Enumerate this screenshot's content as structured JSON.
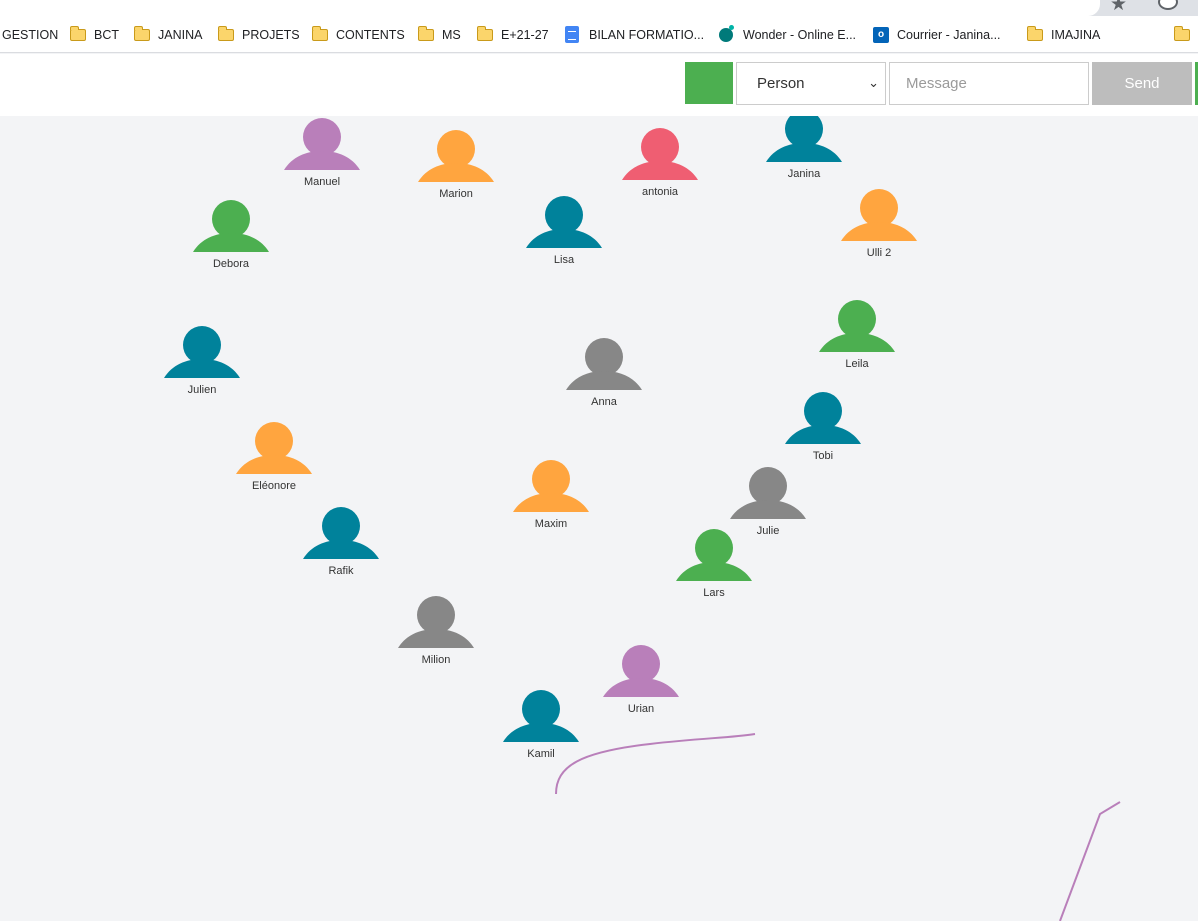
{
  "bookmarks": [
    {
      "label": "GESTION",
      "icon": "none"
    },
    {
      "label": "BCT",
      "icon": "folder-icon"
    },
    {
      "label": "JANINA",
      "icon": "folder-icon"
    },
    {
      "label": "PROJETS",
      "icon": "folder-icon"
    },
    {
      "label": "CONTENTS",
      "icon": "folder-icon"
    },
    {
      "label": "MS",
      "icon": "folder-icon"
    },
    {
      "label": "E+21-27",
      "icon": "folder-icon"
    },
    {
      "label": "BILAN FORMATIO...",
      "icon": "doc-icon"
    },
    {
      "label": "Wonder - Online E...",
      "icon": "wonder-icon"
    },
    {
      "label": "Courrier - Janina...",
      "icon": "outlook-icon"
    },
    {
      "label": "IMAJINA",
      "icon": "folder-icon"
    }
  ],
  "toolbar": {
    "swatch_color": "#4caf50",
    "person_select_value": "Person",
    "message_placeholder": "Message",
    "send_label": "Send"
  },
  "colors": {
    "purple": "#b97fba",
    "orange": "#ffa53f",
    "red": "#ef5e72",
    "teal": "#00829b",
    "green": "#4caf50",
    "gray": "#878787",
    "line": "#b97fba"
  },
  "people": [
    {
      "name": "Manuel",
      "color": "purple"
    },
    {
      "name": "Marion",
      "color": "orange"
    },
    {
      "name": "antonia",
      "color": "red"
    },
    {
      "name": "Janina",
      "color": "teal"
    },
    {
      "name": "Debora",
      "color": "green"
    },
    {
      "name": "Lisa",
      "color": "teal"
    },
    {
      "name": "Ulli 2",
      "color": "orange"
    },
    {
      "name": "Leila",
      "color": "green"
    },
    {
      "name": "Julien",
      "color": "teal"
    },
    {
      "name": "Anna",
      "color": "gray"
    },
    {
      "name": "Tobi",
      "color": "teal"
    },
    {
      "name": "Eléonore",
      "color": "orange"
    },
    {
      "name": "Maxim",
      "color": "orange"
    },
    {
      "name": "Julie",
      "color": "gray"
    },
    {
      "name": "Rafik",
      "color": "teal"
    },
    {
      "name": "Lars",
      "color": "green"
    },
    {
      "name": "Milion",
      "color": "gray"
    },
    {
      "name": "Urian",
      "color": "purple"
    },
    {
      "name": "Kamil",
      "color": "teal"
    }
  ]
}
